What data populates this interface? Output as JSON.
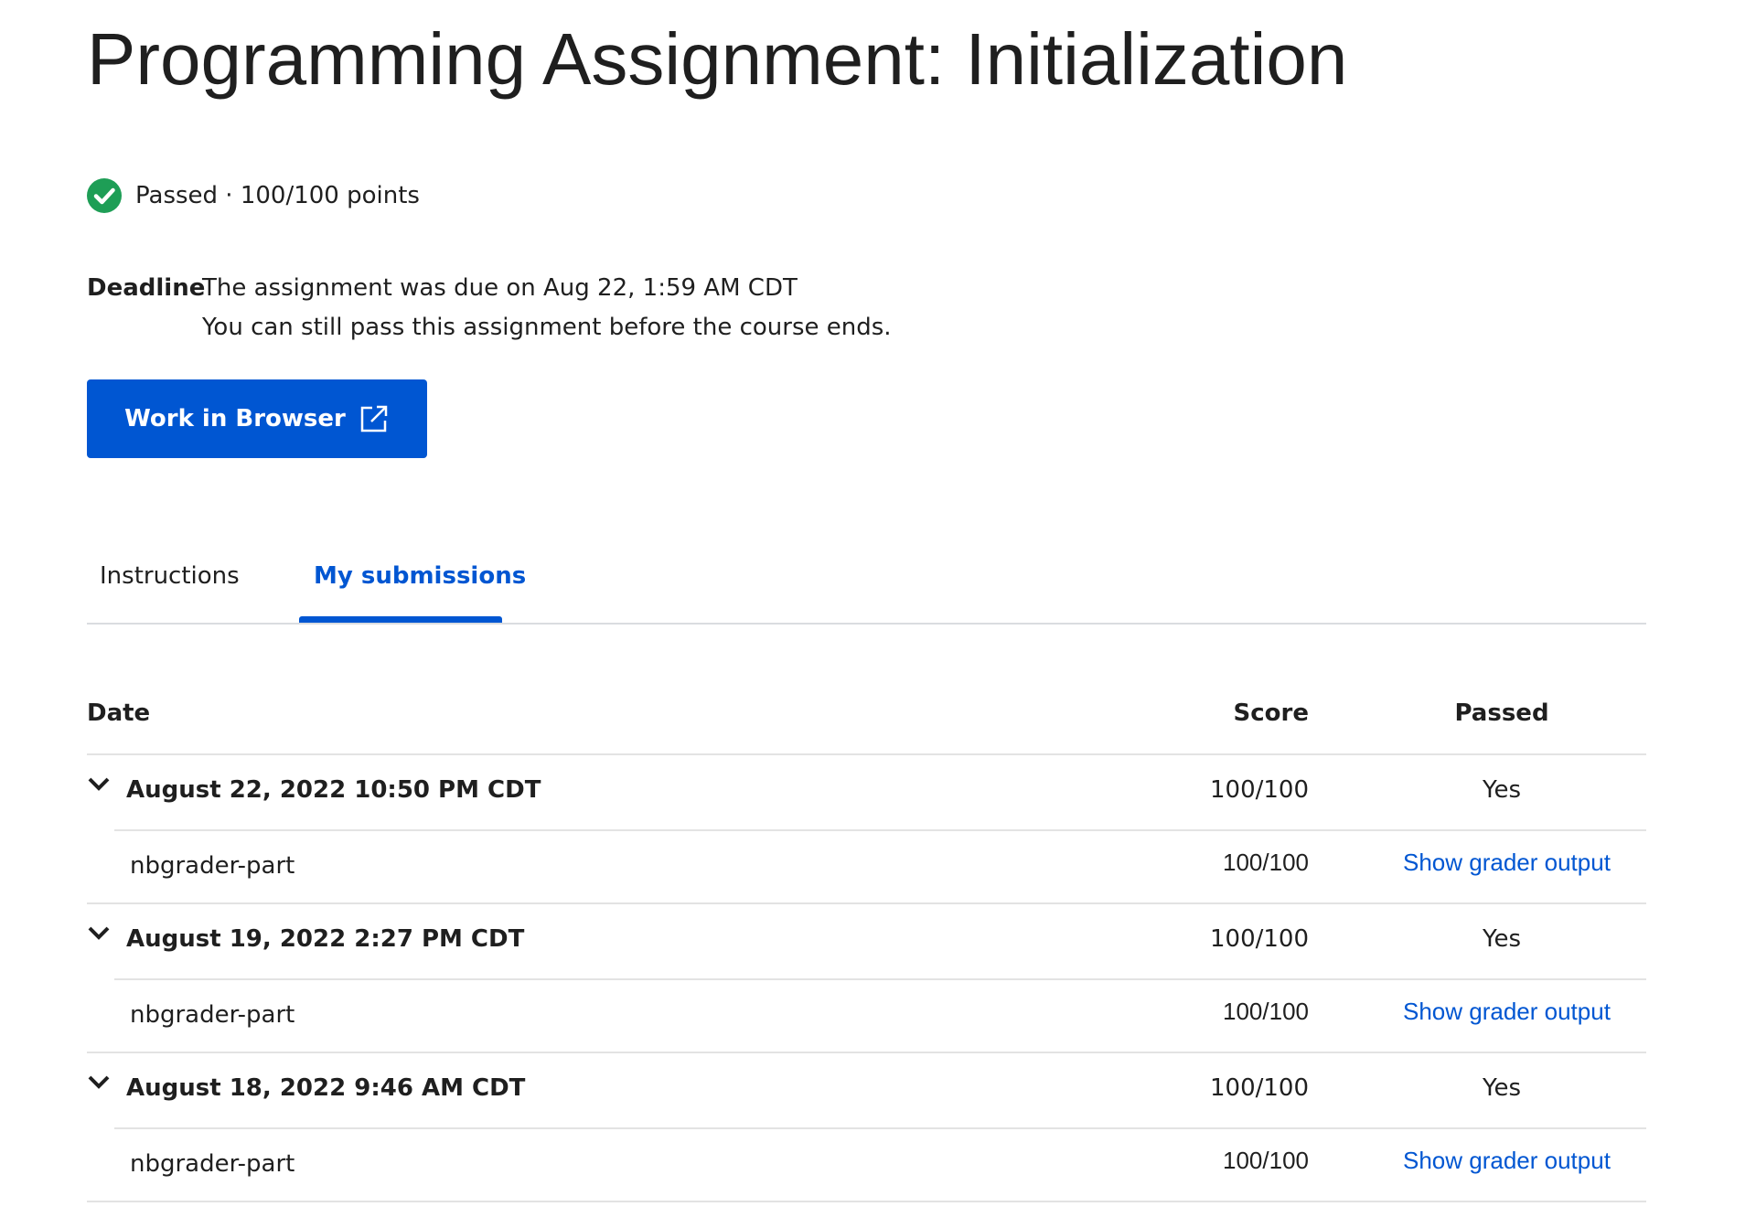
{
  "page": {
    "title": "Programming Assignment: Initialization"
  },
  "status": {
    "icon": "check-circle-icon",
    "text": "Passed · 100/100 points",
    "color": "#1e9e56"
  },
  "deadline": {
    "label": "Deadline",
    "line1": "The assignment was due on Aug 22, 1:59 AM CDT",
    "line2": "You can still pass this assignment before the course ends."
  },
  "browser_button": {
    "label": "Work in Browser",
    "icon": "external-link-icon",
    "color": "#0056d2"
  },
  "tabs": [
    {
      "label": "Instructions",
      "active": false
    },
    {
      "label": "My submissions",
      "active": true
    }
  ],
  "table": {
    "headers": {
      "date": "Date",
      "score": "Score",
      "passed": "Passed"
    },
    "submissions": [
      {
        "date": "August 22, 2022 10:50 PM CDT",
        "score": "100/100",
        "passed": "Yes",
        "part": {
          "name": "nbgrader-part",
          "score": "100/100",
          "link": "Show grader output"
        }
      },
      {
        "date": "August 19, 2022 2:27 PM CDT",
        "score": "100/100",
        "passed": "Yes",
        "part": {
          "name": "nbgrader-part",
          "score": "100/100",
          "link": "Show grader output"
        }
      },
      {
        "date": "August 18, 2022 9:46 AM CDT",
        "score": "100/100",
        "passed": "Yes",
        "part": {
          "name": "nbgrader-part",
          "score": "100/100",
          "link": "Show grader output"
        }
      }
    ]
  }
}
